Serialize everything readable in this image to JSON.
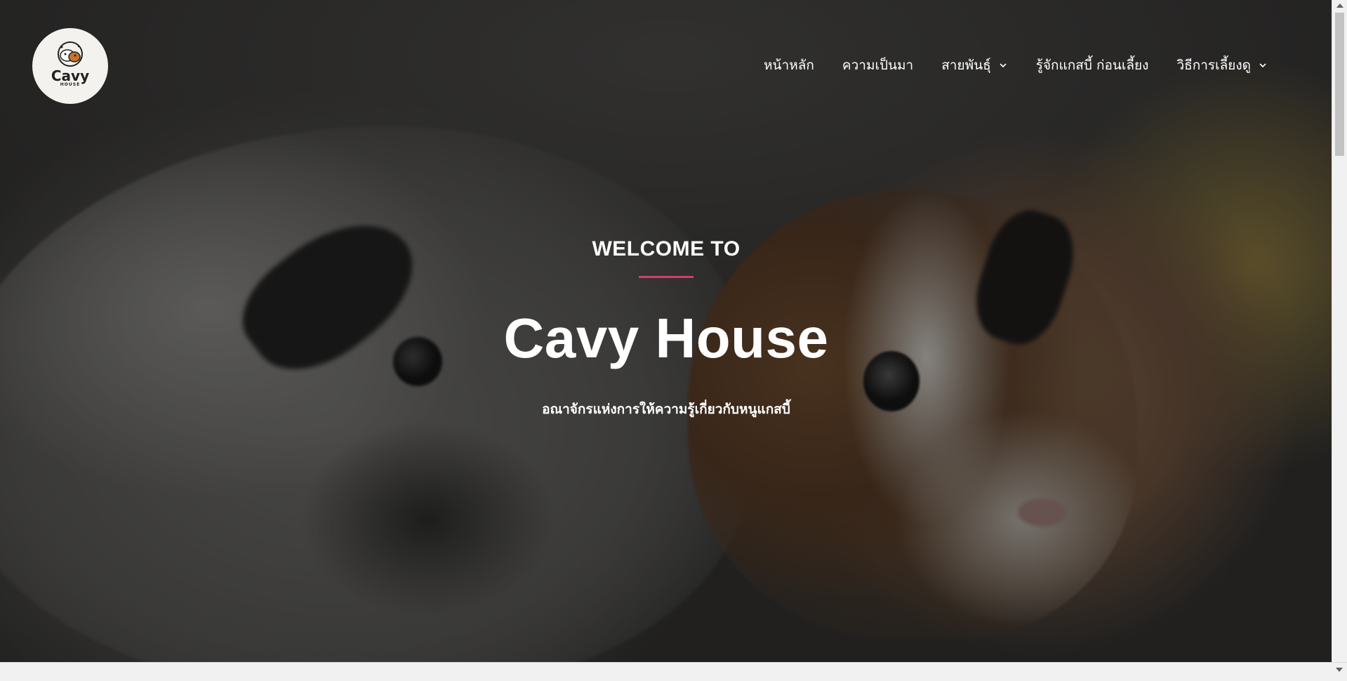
{
  "site": {
    "logo": {
      "title": "Cavy",
      "subtitle": "HOUSE",
      "icon": "guinea-pig-logo-icon"
    }
  },
  "nav": {
    "items": [
      {
        "label": "หน้าหลัก",
        "has_dropdown": false
      },
      {
        "label": "ความเป็นมา",
        "has_dropdown": false
      },
      {
        "label": "สายพันธุ์",
        "has_dropdown": true
      },
      {
        "label": "รู้จักแกสบี้ ก่อนเลี้ยง",
        "has_dropdown": false
      },
      {
        "label": "วิธีการเลี้ยงดู",
        "has_dropdown": true
      }
    ],
    "dropdown_icon": "chevron-down-icon"
  },
  "hero": {
    "kicker": "WELCOME TO",
    "title": "Cavy House",
    "subtitle": "อณาจักรแห่งการให้ความรู้เกี่ยวกับหนูแกสบี้",
    "accent_color": "#d43d6b",
    "background": "guinea-pigs-photo"
  }
}
